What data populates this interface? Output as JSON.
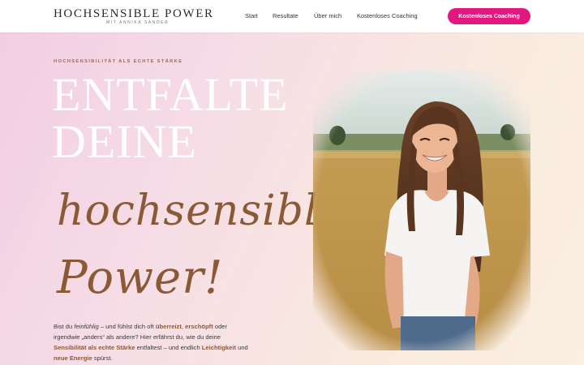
{
  "header": {
    "logo_title": "HOCHSENSIBLE POWER",
    "logo_subtitle": "MIT ANNIKA SANDER",
    "nav": {
      "start": "Start",
      "results": "Resultate",
      "about": "Über mich",
      "free_coaching": "Kostenloses Coaching"
    },
    "cta_label": "Kostenloses Coaching"
  },
  "hero": {
    "eyebrow": "HOCHSENSIBILITÄT ALS ECHTE STÄRKE",
    "headline_line1": "ENTFALTE",
    "headline_line2": "DEINE",
    "script_line1": "hochsensible",
    "script_line2": "Power!",
    "body": {
      "t1": "Bist du ",
      "feinfuehlig": "feinfühlig",
      "t2": " – und fühlst dich oft ",
      "ueberreizt": "überreizt",
      "t3": ", ",
      "erschoepft": "erschöpft",
      "t4": " oder irgendwie „anders“ als andere? Hier erfährst du, wie du deine ",
      "staerke": "Sensibilität als echte Stärke",
      "t5": " entfaltest – und endlich ",
      "leichtigkeit": "Leichtigkeit",
      "t6": " und ",
      "energie": "neue Energie",
      "t7": " spürst."
    }
  },
  "colors": {
    "accent": "#e2177f",
    "brown": "#8a5a36",
    "eyebrow": "#9b6b52"
  }
}
